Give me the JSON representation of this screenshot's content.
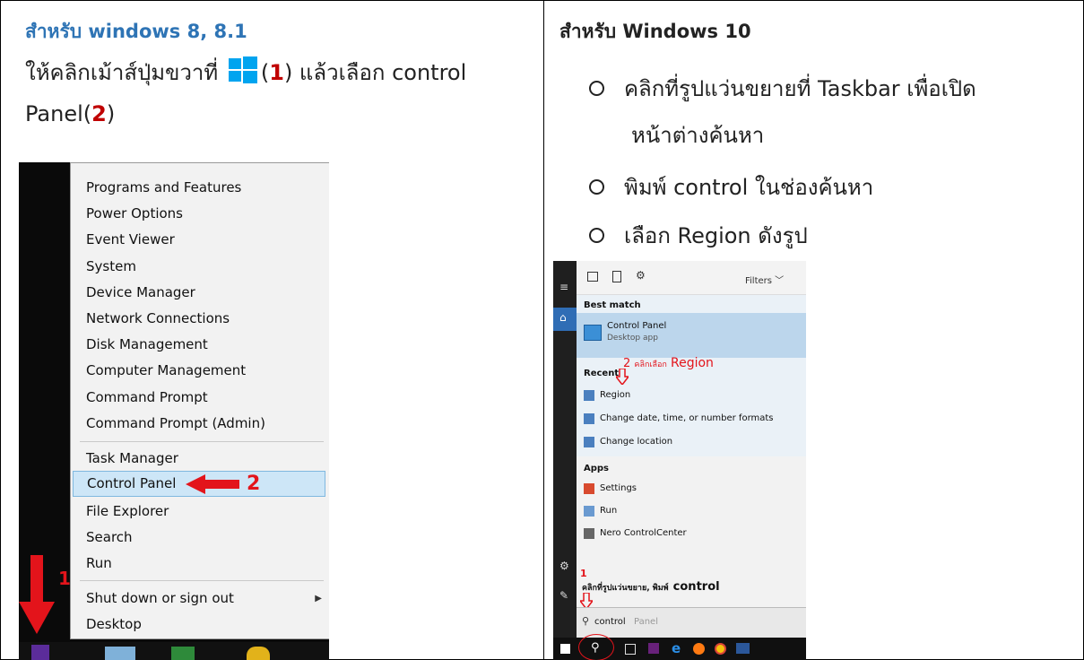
{
  "left": {
    "heading": "สำหรับ windows 8, 8.1",
    "line1_before": "ให้คลิกเม้าส์ปุ่มขวาที่",
    "line1_num_open": "(",
    "line1_num": "1",
    "line1_after": ") แล้วเลือก control",
    "line2_before": "Panel(",
    "line2_num": "2",
    "line2_after": ")",
    "menu_items": [
      "Programs and Features",
      "Power Options",
      "Event Viewer",
      "System",
      "Device Manager",
      "Network Connections",
      "Disk Management",
      "Computer Management",
      "Command Prompt",
      "Command Prompt (Admin)",
      "Task Manager",
      "Control Panel",
      "File Explorer",
      "Search",
      "Run",
      "Shut down or sign out",
      "Desktop"
    ],
    "step1_label": "1",
    "step2_label": "2"
  },
  "right": {
    "heading": "สำหรับ Windows 10",
    "bullet1_line1": "คลิกที่รูปแว่นขยายที่ Taskbar เพื่อเปิด",
    "bullet1_line2": "หน้าต่างค้นหา",
    "bullet2": "พิมพ์ control ในช่องค้นหา",
    "bullet3": "เลือก Region ดังรูป",
    "filters_label": "Filters",
    "best_match_label": "Best match",
    "best_match_title": "Control Panel",
    "best_match_sub": "Desktop app",
    "recent_label": "Recent",
    "recent_items": [
      "Region",
      "Change date, time, or number formats",
      "Change location"
    ],
    "apps_label": "Apps",
    "apps_items": [
      "Settings",
      "Run",
      "Nero ControlCenter"
    ],
    "annot2_num": "2",
    "annot2_small": "คลิกเลือก",
    "annot2_big": "Region",
    "annot1_num": "1",
    "annot1_small": "คลิกที่รูปแว่นขยาย, พิมพ์",
    "annot1_big": "control",
    "search_typed": "control",
    "search_hint": "Panel"
  },
  "colors": {
    "heading_blue": "#2e74b5",
    "step_red": "#c00000",
    "annot_red": "#e3141b",
    "menu_selected": "#cde6f7",
    "search_highlight": "#bcd6ec"
  }
}
